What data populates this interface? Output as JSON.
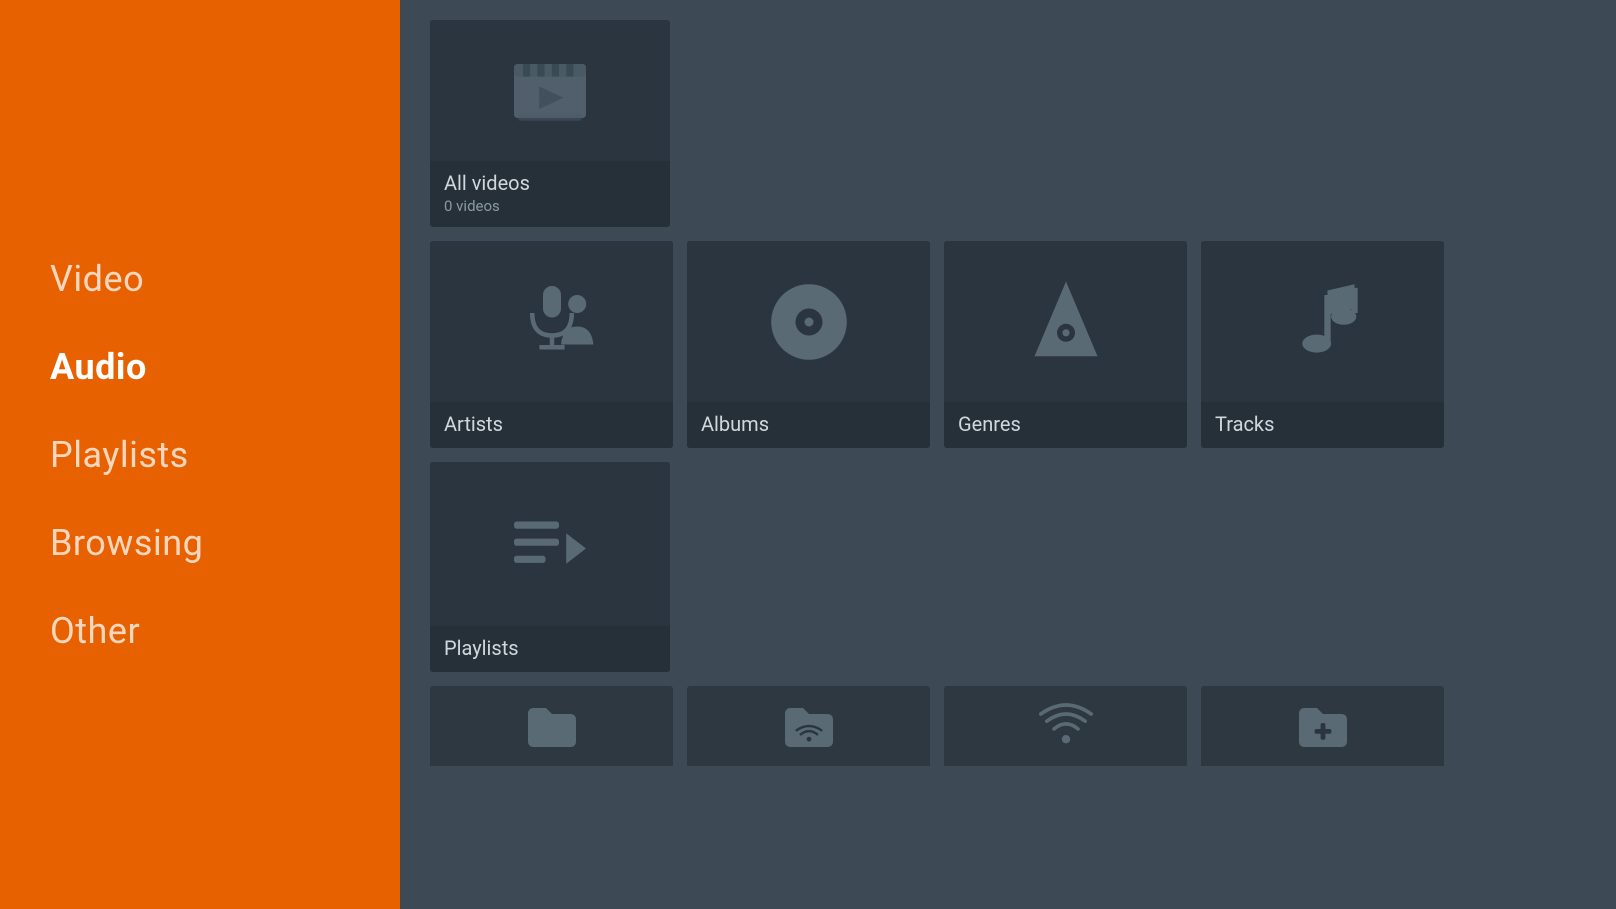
{
  "sidebar": {
    "items": [
      {
        "id": "video",
        "label": "Video",
        "active": false
      },
      {
        "id": "audio",
        "label": "Audio",
        "active": true
      },
      {
        "id": "playlists",
        "label": "Playlists",
        "active": false
      },
      {
        "id": "browsing",
        "label": "Browsing",
        "active": false
      },
      {
        "id": "other",
        "label": "Other",
        "active": false
      }
    ]
  },
  "main": {
    "row1": {
      "cards": [
        {
          "id": "all-videos",
          "label": "All videos",
          "sublabel": "0 videos",
          "icon": "film"
        }
      ]
    },
    "row2": {
      "cards": [
        {
          "id": "artists",
          "label": "Artists",
          "sublabel": "",
          "icon": "artists"
        },
        {
          "id": "albums",
          "label": "Albums",
          "sublabel": "",
          "icon": "albums"
        },
        {
          "id": "genres",
          "label": "Genres",
          "sublabel": "",
          "icon": "genres"
        },
        {
          "id": "tracks",
          "label": "Tracks",
          "sublabel": "",
          "icon": "tracks"
        }
      ]
    },
    "row3": {
      "cards": [
        {
          "id": "playlists-card",
          "label": "Playlists",
          "sublabel": "",
          "icon": "playlists"
        }
      ]
    },
    "row4": {
      "cards": [
        {
          "id": "local-folder",
          "label": "",
          "icon": "folder"
        },
        {
          "id": "network-folder",
          "label": "",
          "icon": "network-folder"
        },
        {
          "id": "upnp",
          "label": "",
          "icon": "upnp"
        },
        {
          "id": "add-folder",
          "label": "",
          "icon": "add-folder"
        }
      ]
    }
  },
  "colors": {
    "sidebar_bg": "#e86100",
    "main_bg": "#3d4a55",
    "card_bg": "#2e3840",
    "card_label_bg": "#263038",
    "icon_fill": "#5a6a75"
  }
}
